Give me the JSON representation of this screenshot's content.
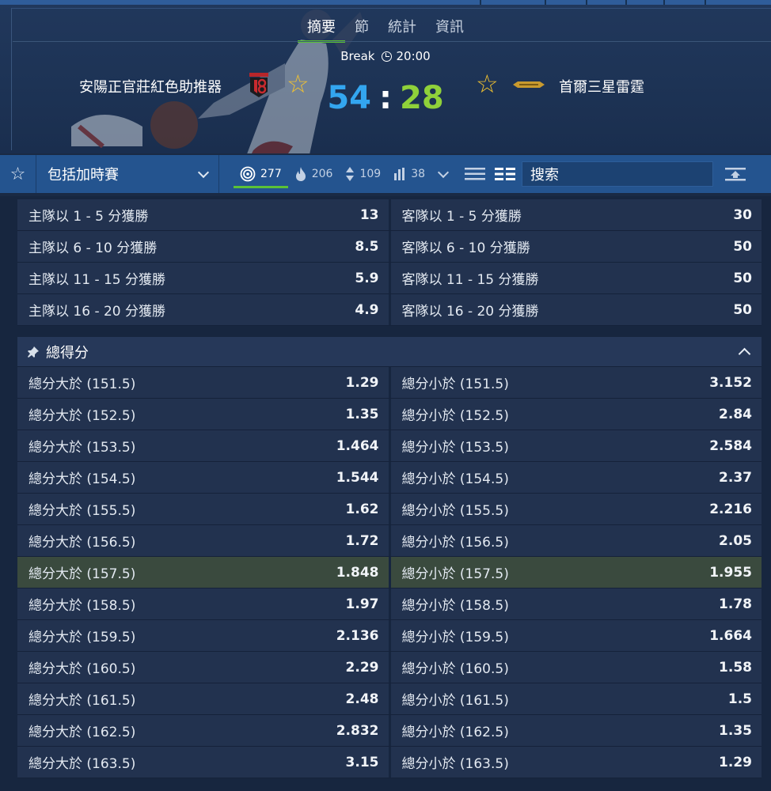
{
  "header": {
    "tabs": [
      "摘要",
      "節",
      "統計",
      "資訊"
    ],
    "active_tab": 0,
    "status": "Break",
    "time": "20:00",
    "home_team": "安陽正官莊紅色助推器",
    "away_team": "首爾三星雷霆",
    "home_score": "54",
    "score_separator": ":",
    "away_score": "28",
    "colors": {
      "home_score": "#33a6f0",
      "away_score": "#8fd13a",
      "star": "#f2c230",
      "active_tab_underline": "#5bc236"
    }
  },
  "toolbar": {
    "favorite_icon": "star-outline-icon",
    "selector_value": "包括加時賽",
    "filters": [
      {
        "icon": "target-icon",
        "count": "277"
      },
      {
        "icon": "fire-icon",
        "count": "206"
      },
      {
        "icon": "sort-arrows-icon",
        "count": "109"
      },
      {
        "icon": "bar-chart-icon",
        "count": "38"
      }
    ],
    "search_placeholder": "搜索"
  },
  "margin_market": {
    "rows": [
      {
        "left_label": "主隊以 1 - 5 分獲勝",
        "left_odds": "13",
        "right_label": "客隊以 1 - 5 分獲勝",
        "right_odds": "30"
      },
      {
        "left_label": "主隊以 6 - 10 分獲勝",
        "left_odds": "8.5",
        "right_label": "客隊以 6 - 10 分獲勝",
        "right_odds": "50"
      },
      {
        "left_label": "主隊以 11 - 15 分獲勝",
        "left_odds": "5.9",
        "right_label": "客隊以 11 - 15 分獲勝",
        "right_odds": "50"
      },
      {
        "left_label": "主隊以 16 - 20 分獲勝",
        "left_odds": "4.9",
        "right_label": "客隊以 16 - 20 分獲勝",
        "right_odds": "50"
      }
    ]
  },
  "total_market": {
    "title": "總得分",
    "highlight_row": 6,
    "rows": [
      {
        "left_label": "總分大於 (151.5)",
        "left_odds": "1.29",
        "right_label": "總分小於 (151.5)",
        "right_odds": "3.152"
      },
      {
        "left_label": "總分大於 (152.5)",
        "left_odds": "1.35",
        "right_label": "總分小於 (152.5)",
        "right_odds": "2.84"
      },
      {
        "left_label": "總分大於 (153.5)",
        "left_odds": "1.464",
        "right_label": "總分小於 (153.5)",
        "right_odds": "2.584"
      },
      {
        "left_label": "總分大於 (154.5)",
        "left_odds": "1.544",
        "right_label": "總分小於 (154.5)",
        "right_odds": "2.37"
      },
      {
        "left_label": "總分大於 (155.5)",
        "left_odds": "1.62",
        "right_label": "總分小於 (155.5)",
        "right_odds": "2.216"
      },
      {
        "left_label": "總分大於 (156.5)",
        "left_odds": "1.72",
        "right_label": "總分小於 (156.5)",
        "right_odds": "2.05"
      },
      {
        "left_label": "總分大於 (157.5)",
        "left_odds": "1.848",
        "right_label": "總分小於 (157.5)",
        "right_odds": "1.955"
      },
      {
        "left_label": "總分大於 (158.5)",
        "left_odds": "1.97",
        "right_label": "總分小於 (158.5)",
        "right_odds": "1.78"
      },
      {
        "left_label": "總分大於 (159.5)",
        "left_odds": "2.136",
        "right_label": "總分小於 (159.5)",
        "right_odds": "1.664"
      },
      {
        "left_label": "總分大於 (160.5)",
        "left_odds": "2.29",
        "right_label": "總分小於 (160.5)",
        "right_odds": "1.58"
      },
      {
        "left_label": "總分大於 (161.5)",
        "left_odds": "2.48",
        "right_label": "總分小於 (161.5)",
        "right_odds": "1.5"
      },
      {
        "left_label": "總分大於 (162.5)",
        "left_odds": "2.832",
        "right_label": "總分小於 (162.5)",
        "right_odds": "1.35"
      },
      {
        "left_label": "總分大於 (163.5)",
        "left_odds": "3.15",
        "right_label": "總分小於 (163.5)",
        "right_odds": "1.29"
      }
    ]
  }
}
